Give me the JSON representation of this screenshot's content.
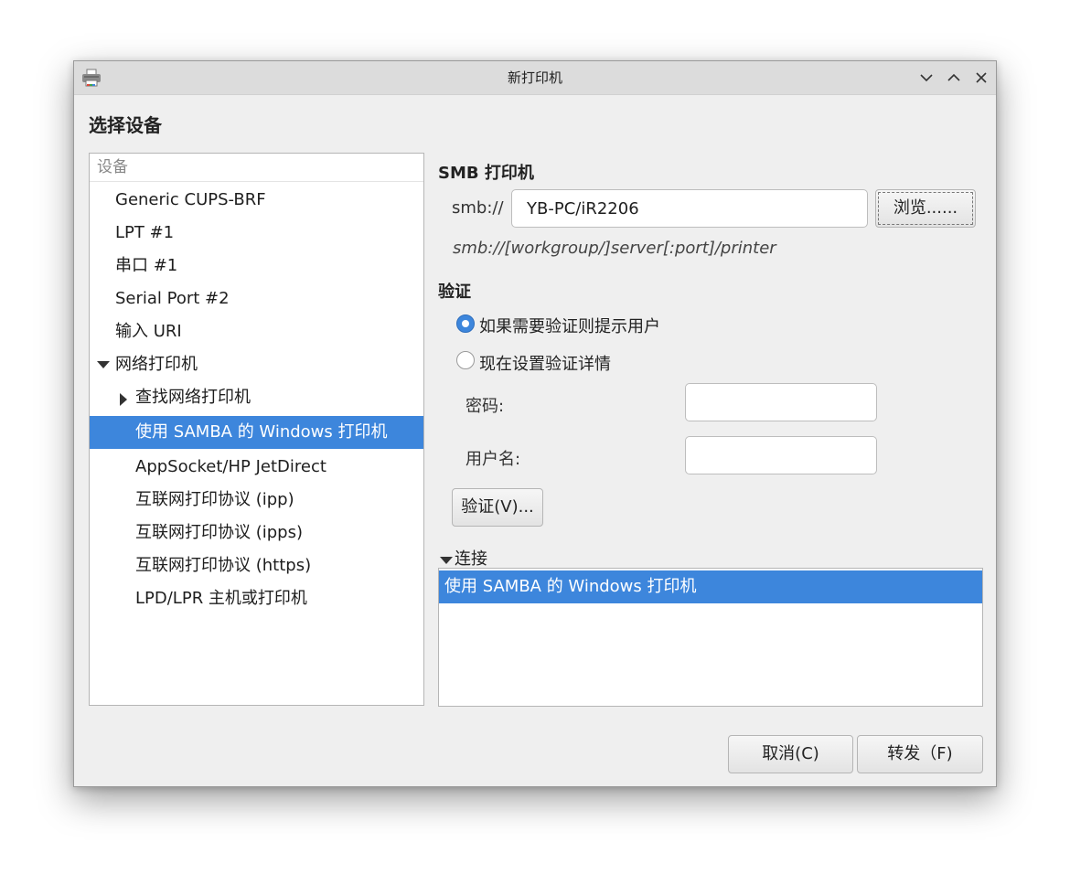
{
  "window": {
    "title": "新打印机",
    "controls": {
      "minimize_icon": "chevron-down-icon",
      "maximize_icon": "chevron-up-icon",
      "close_icon": "close-icon"
    }
  },
  "heading": "选择设备",
  "device_list": {
    "header": "设备",
    "items": [
      {
        "label": "Generic CUPS-BRF"
      },
      {
        "label": "LPT #1"
      },
      {
        "label": "串口 #1"
      },
      {
        "label": "Serial Port #2"
      },
      {
        "label": "输入 URI"
      },
      {
        "label": "网络打印机",
        "expanded": true
      },
      {
        "label": "查找网络打印机",
        "expanded": false
      },
      {
        "label": "使用 SAMBA 的 Windows 打印机",
        "selected": true
      },
      {
        "label": "AppSocket/HP JetDirect"
      },
      {
        "label": "互联网打印协议 (ipp)"
      },
      {
        "label": "互联网打印协议 (ipps)"
      },
      {
        "label": "互联网打印协议 (https)"
      },
      {
        "label": "LPD/LPR 主机或打印机"
      }
    ]
  },
  "smb": {
    "section_title": "SMB 打印机",
    "prefix": "smb://",
    "uri_value": "YB-PC/iR2206",
    "browse_label": "浏览......",
    "format_hint": "smb://[workgroup/]server[:port]/printer"
  },
  "auth": {
    "section_title": "验证",
    "option_prompt": "如果需要验证则提示用户",
    "option_now": "现在设置验证详情",
    "selected_option": "option_prompt",
    "password_label": "密码:",
    "password_value": "",
    "username_label": "用户名:",
    "username_value": "",
    "verify_label": "验证(V)..."
  },
  "connection": {
    "expander_label": "连接",
    "expanded": true,
    "items": [
      "使用 SAMBA 的 Windows 打印机"
    ]
  },
  "footer": {
    "cancel_label": "取消(C)",
    "forward_label": "转发（F)"
  },
  "colors": {
    "selection": "#3d86dc",
    "window_bg": "#efefef",
    "titlebar_bg": "#dcdcdc"
  }
}
